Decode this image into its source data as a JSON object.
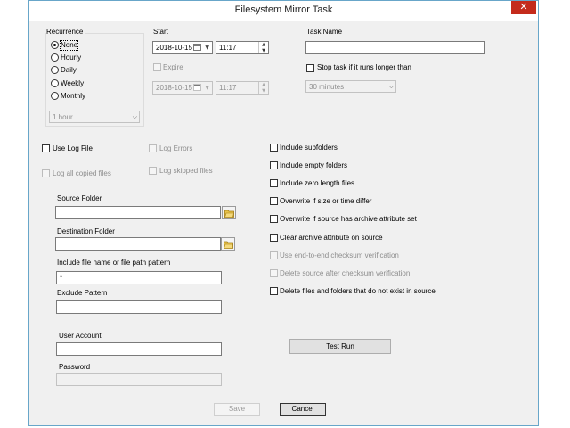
{
  "window": {
    "title": "Filesystem Mirror Task",
    "close_glyph": "✕"
  },
  "recurrence": {
    "label": "Recurrence",
    "options": [
      "None",
      "Hourly",
      "Daily",
      "Weekly",
      "Monthly"
    ],
    "selected": "None",
    "interval_value": "1 hour"
  },
  "start": {
    "label": "Start",
    "date": "2018-10-15",
    "time": "11:17"
  },
  "expire": {
    "label": "Expire",
    "checked": false,
    "date": "2018-10-15",
    "time": "11:17"
  },
  "task_name": {
    "label": "Task Name",
    "value": ""
  },
  "stop_task": {
    "label": "Stop task if it runs longer than",
    "checked": false,
    "duration": "30 minutes"
  },
  "logging": {
    "use_log_file": "Use Log File",
    "log_errors": "Log Errors",
    "log_all_copied": "Log all copied files",
    "log_skipped": "Log skipped files"
  },
  "folders": {
    "source_label": "Source Folder",
    "source_value": "",
    "destination_label": "Destination Folder",
    "destination_value": "",
    "include_label": "Include file name or file path pattern",
    "include_value": "*",
    "exclude_label": "Exclude Pattern",
    "exclude_value": ""
  },
  "account": {
    "user_label": "User Account",
    "user_value": "",
    "password_label": "Password",
    "password_value": ""
  },
  "options": [
    {
      "label": "Include subfolders",
      "enabled": true
    },
    {
      "label": "Include empty folders",
      "enabled": true
    },
    {
      "label": "Include zero length files",
      "enabled": true
    },
    {
      "label": "Overwrite if size or time differ",
      "enabled": true
    },
    {
      "label": "Overwrite if source has archive attribute set",
      "enabled": true
    },
    {
      "label": "Clear archive attribute on source",
      "enabled": true
    },
    {
      "label": "Use end-to-end checksum verification",
      "enabled": false
    },
    {
      "label": "Delete source after checksum verification",
      "enabled": false
    },
    {
      "label": "Delete files and folders that do not exist in source",
      "enabled": true
    }
  ],
  "buttons": {
    "test_run": "Test Run",
    "save": "Save",
    "cancel": "Cancel"
  },
  "colors": {
    "close": "#c42b1c",
    "border": "#68a6c9",
    "background": "#f0f0f0"
  }
}
